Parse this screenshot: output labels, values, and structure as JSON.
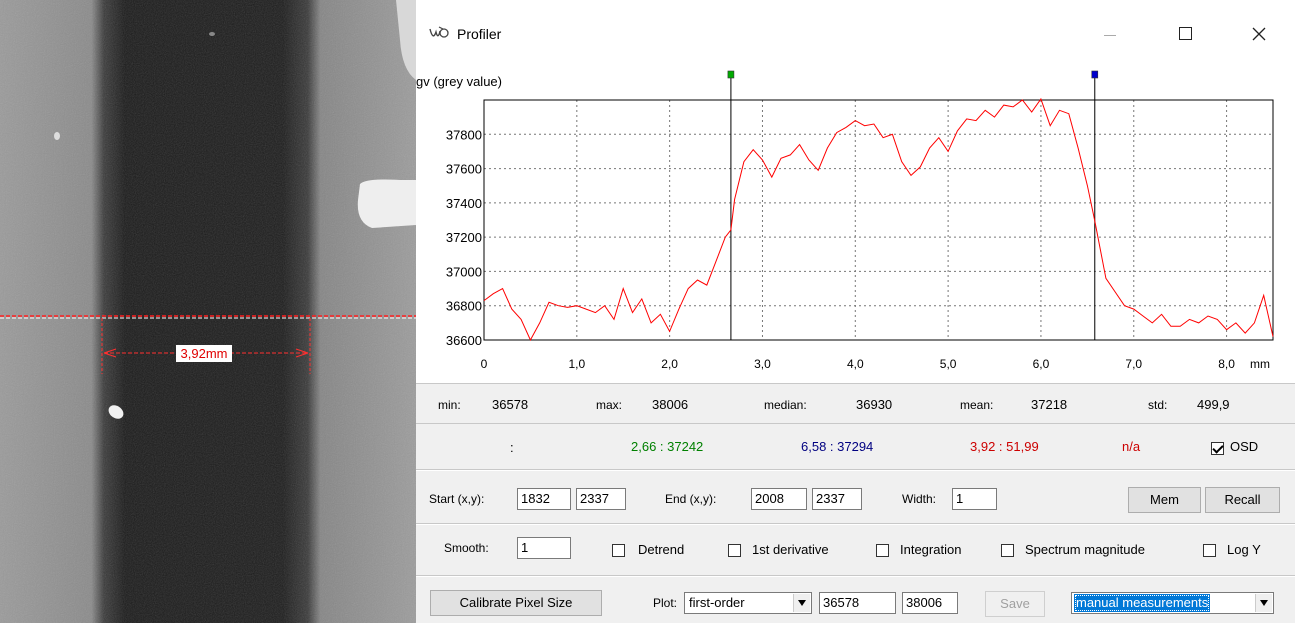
{
  "image": {
    "measure_label": "3,92mm"
  },
  "window": {
    "title": "Profiler",
    "icon": "profiler-icon",
    "controls": [
      "minimize-icon",
      "maximize-icon",
      "close-icon"
    ]
  },
  "chart_data": {
    "type": "line",
    "ylabel": "gv (grey value)",
    "xunit": "mm",
    "xlim": [
      0,
      8.5
    ],
    "ylim": [
      36600,
      38000
    ],
    "x_ticks": [
      "0",
      "1,0",
      "2,0",
      "3,0",
      "4,0",
      "5,0",
      "6,0",
      "7,0",
      "8,0"
    ],
    "y_ticks": [
      "36600",
      "36800",
      "37000",
      "37200",
      "37400",
      "37600",
      "37800"
    ],
    "grid": true,
    "line_color": "#ff0000",
    "markers": [
      {
        "x": 2.66,
        "color": "#00aa00"
      },
      {
        "x": 6.58,
        "color": "#0000cc"
      }
    ],
    "series": [
      {
        "x": [
          0,
          0.1,
          0.2,
          0.3,
          0.4,
          0.5,
          0.6,
          0.7,
          0.8,
          0.9,
          1.0,
          1.1,
          1.2,
          1.3,
          1.4,
          1.5,
          1.6,
          1.7,
          1.8,
          1.9,
          2.0,
          2.1,
          2.2,
          2.3,
          2.4,
          2.5,
          2.6,
          2.66,
          2.7,
          2.8,
          2.9,
          3.0,
          3.1,
          3.2,
          3.3,
          3.4,
          3.5,
          3.6,
          3.7,
          3.8,
          3.9,
          4.0,
          4.1,
          4.2,
          4.3,
          4.4,
          4.5,
          4.6,
          4.7,
          4.8,
          4.9,
          5.0,
          5.1,
          5.2,
          5.3,
          5.4,
          5.5,
          5.6,
          5.7,
          5.8,
          5.9,
          6.0,
          6.1,
          6.2,
          6.3,
          6.4,
          6.5,
          6.58,
          6.7,
          6.8,
          6.9,
          7.0,
          7.1,
          7.2,
          7.3,
          7.4,
          7.5,
          7.6,
          7.7,
          7.8,
          7.9,
          8.0,
          8.1,
          8.2,
          8.3,
          8.4,
          8.5
        ],
        "y": [
          36830,
          36870,
          36900,
          36780,
          36720,
          36600,
          36700,
          36820,
          36800,
          36790,
          36800,
          36780,
          36760,
          36800,
          36720,
          36900,
          36760,
          36840,
          36700,
          36750,
          36650,
          36780,
          36900,
          36950,
          36920,
          37060,
          37200,
          37242,
          37420,
          37640,
          37710,
          37650,
          37550,
          37660,
          37680,
          37740,
          37650,
          37590,
          37720,
          37810,
          37840,
          37880,
          37850,
          37860,
          37780,
          37800,
          37640,
          37560,
          37610,
          37720,
          37780,
          37700,
          37820,
          37890,
          37880,
          37940,
          37900,
          37970,
          37960,
          38000,
          37930,
          38006,
          37850,
          37940,
          37920,
          37720,
          37500,
          37294,
          36960,
          36880,
          36800,
          36780,
          36740,
          36700,
          36750,
          36680,
          36680,
          36720,
          36700,
          36740,
          36720,
          36660,
          36700,
          36640,
          36700,
          36860,
          36620
        ]
      }
    ]
  },
  "stats": {
    "min_label": "min:",
    "min": "36578",
    "max_label": "max:",
    "max": "38006",
    "median_label": "median:",
    "median": "36930",
    "mean_label": "mean:",
    "mean": "37218",
    "std_label": "std:",
    "std": "499,9"
  },
  "readout": {
    "colon": ":",
    "cursor1": "2,66 : 37242",
    "cursor1_color": "#008000",
    "cursor2": "6,58 : 37294",
    "cursor2_color": "#000080",
    "diff": "3,92 : 51,99",
    "diff_color": "#cc0000",
    "na": "n/a",
    "osd_label": "OSD"
  },
  "coords": {
    "start_label": "Start (x,y):",
    "start_x": "1832",
    "start_y": "2337",
    "end_label": "End (x,y):",
    "end_x": "2008",
    "end_y": "2337",
    "width_label": "Width:",
    "width": "1",
    "mem_button": "Mem",
    "recall_button": "Recall"
  },
  "options": {
    "smooth_label": "Smooth:",
    "smooth": "1",
    "detrend": "Detrend",
    "first_derivative": "1st derivative",
    "integration": "Integration",
    "spectrum": "Spectrum magnitude",
    "logy": "Log Y"
  },
  "bottom": {
    "calibrate_button": "Calibrate Pixel Size",
    "plot_label": "Plot:",
    "plot_mode": "first-order",
    "plot_min": "36578",
    "plot_max": "38006",
    "save_button": "Save",
    "mode_select": "manual measurements"
  }
}
